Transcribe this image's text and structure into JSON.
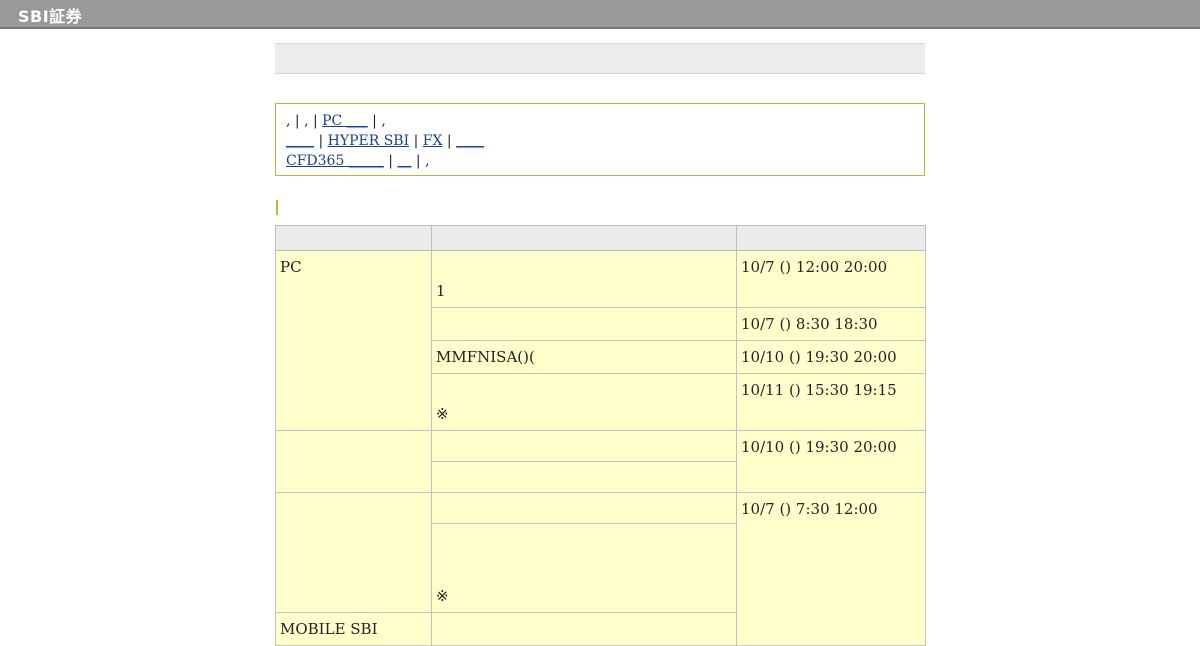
{
  "header": {
    "logo_text": "SBI証券"
  },
  "notice": {
    "line1": {
      "pre": ", | , | ",
      "link": "PC ___",
      "post": "  | ,"
    },
    "line2": {
      "link1": "____",
      "sep1": "  | ",
      "link2": "HYPER SBI",
      "sep2": "  | ",
      "link3": "FX",
      "sep3": "  |  ",
      "link4": "____"
    },
    "line3": {
      "link1": "CFD365 _____",
      "sep1": "  | ",
      "link2": "__",
      "post": "  | ,"
    }
  },
  "schedule": {
    "headers": [
      "",
      "",
      ""
    ],
    "rows": [
      {
        "service": "PC",
        "detail": "1",
        "time": "10/7 () 12:00  20:00"
      },
      {
        "detail": "",
        "time": "10/7 () 8:30  18:30"
      },
      {
        "detail": "MMFNISA()(",
        "time": "10/10 () 19:30  20:00"
      },
      {
        "detail": "※",
        "time": "10/11 () 15:30  19:15"
      },
      {
        "service": "",
        "detail": "",
        "time": "10/10 () 19:30  20:00"
      },
      {
        "detail": ""
      },
      {
        "service": "",
        "detail": "",
        "time": "10/7 () 7:30  12:00"
      },
      {
        "detail": "※"
      },
      {
        "service": "MOBILE SBI",
        "detail": ""
      }
    ]
  }
}
